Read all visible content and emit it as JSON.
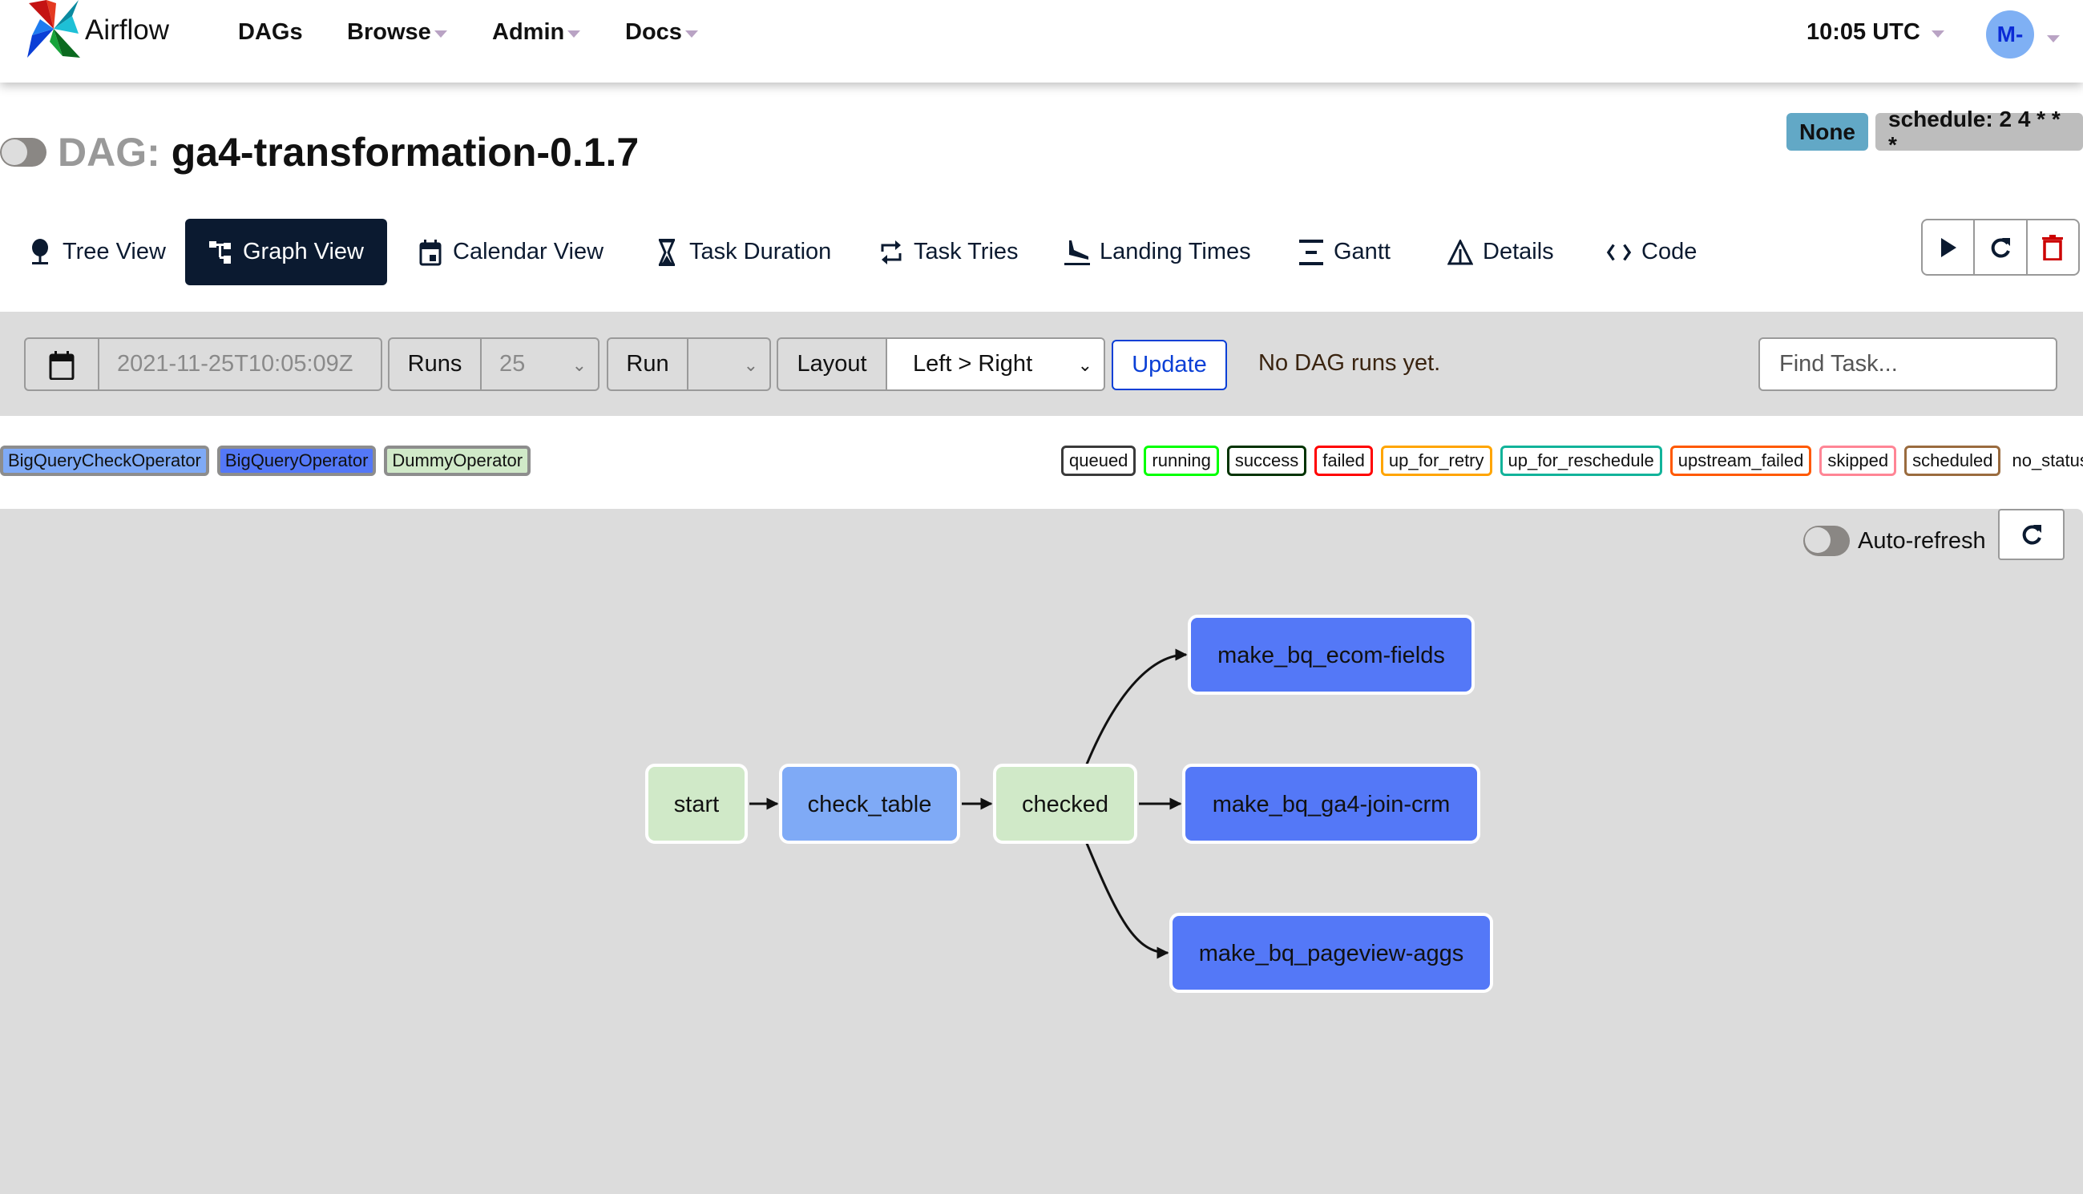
{
  "navbar": {
    "brand": "Airflow",
    "items": [
      {
        "label": "DAGs",
        "dropdown": false
      },
      {
        "label": "Browse",
        "dropdown": true
      },
      {
        "label": "Admin",
        "dropdown": true
      },
      {
        "label": "Docs",
        "dropdown": true
      }
    ],
    "clock": "10:05 UTC",
    "user_initials": "M-"
  },
  "dag": {
    "label": "DAG:",
    "id": "ga4-transformation-0.1.7",
    "paused": true,
    "badges": {
      "owner": "None",
      "schedule": "schedule: 2 4 * * *"
    }
  },
  "tabs": [
    {
      "label": "Tree View",
      "icon": "tree-icon",
      "active": false
    },
    {
      "label": "Graph View",
      "icon": "graph-icon",
      "active": true
    },
    {
      "label": "Calendar View",
      "icon": "calendar-icon",
      "active": false
    },
    {
      "label": "Task Duration",
      "icon": "hourglass-icon",
      "active": false
    },
    {
      "label": "Task Tries",
      "icon": "retry-icon",
      "active": false
    },
    {
      "label": "Landing Times",
      "icon": "landing-icon",
      "active": false
    },
    {
      "label": "Gantt",
      "icon": "gantt-icon",
      "active": false
    },
    {
      "label": "Details",
      "icon": "warning-triangle-icon",
      "active": false
    },
    {
      "label": "Code",
      "icon": "code-icon",
      "active": false
    }
  ],
  "actions": {
    "trigger": "play-icon",
    "refresh": "refresh-icon",
    "delete": "trash-icon"
  },
  "controls": {
    "base_date": "2021-11-25T10:05:09Z",
    "runs_label": "Runs",
    "runs_value": "25",
    "run_label": "Run",
    "run_value": "",
    "layout_label": "Layout",
    "layout_value": "Left > Right",
    "update_label": "Update",
    "status_message": "No DAG runs yet.",
    "find_task_placeholder": "Find Task..."
  },
  "operators": [
    {
      "label": "BigQueryCheckOperator",
      "color": "#7faaf6"
    },
    {
      "label": "BigQueryOperator",
      "color": "#5478f7"
    },
    {
      "label": "DummyOperator",
      "color": "#d0e9c8"
    }
  ],
  "states": [
    {
      "label": "queued",
      "color": "#3a3a3a"
    },
    {
      "label": "running",
      "color": "#00ff00"
    },
    {
      "label": "success",
      "color": "#003300"
    },
    {
      "label": "failed",
      "color": "#ff0000"
    },
    {
      "label": "up_for_retry",
      "color": "#ffa500"
    },
    {
      "label": "up_for_reschedule",
      "color": "#12b39a"
    },
    {
      "label": "upstream_failed",
      "color": "#ff5900"
    },
    {
      "label": "skipped",
      "color": "#ff8595"
    },
    {
      "label": "scheduled",
      "color": "#9a6b3e"
    },
    {
      "label": "no_status",
      "color": null
    }
  ],
  "graph": {
    "auto_refresh_label": "Auto-refresh",
    "auto_refresh_on": false,
    "nodes": [
      {
        "id": "start",
        "label": "start",
        "operator": "DummyOperator"
      },
      {
        "id": "check_table",
        "label": "check_table",
        "operator": "BigQueryCheckOperator"
      },
      {
        "id": "checked",
        "label": "checked",
        "operator": "DummyOperator"
      },
      {
        "id": "make_bq_ecom-fields",
        "label": "make_bq_ecom-fields",
        "operator": "BigQueryOperator"
      },
      {
        "id": "make_bq_ga4-join-crm",
        "label": "make_bq_ga4-join-crm",
        "operator": "BigQueryOperator"
      },
      {
        "id": "make_bq_pageview-aggs",
        "label": "make_bq_pageview-aggs",
        "operator": "BigQueryOperator"
      }
    ],
    "edges": [
      [
        "start",
        "check_table"
      ],
      [
        "check_table",
        "checked"
      ],
      [
        "checked",
        "make_bq_ecom-fields"
      ],
      [
        "checked",
        "make_bq_ga4-join-crm"
      ],
      [
        "checked",
        "make_bq_pageview-aggs"
      ]
    ]
  }
}
